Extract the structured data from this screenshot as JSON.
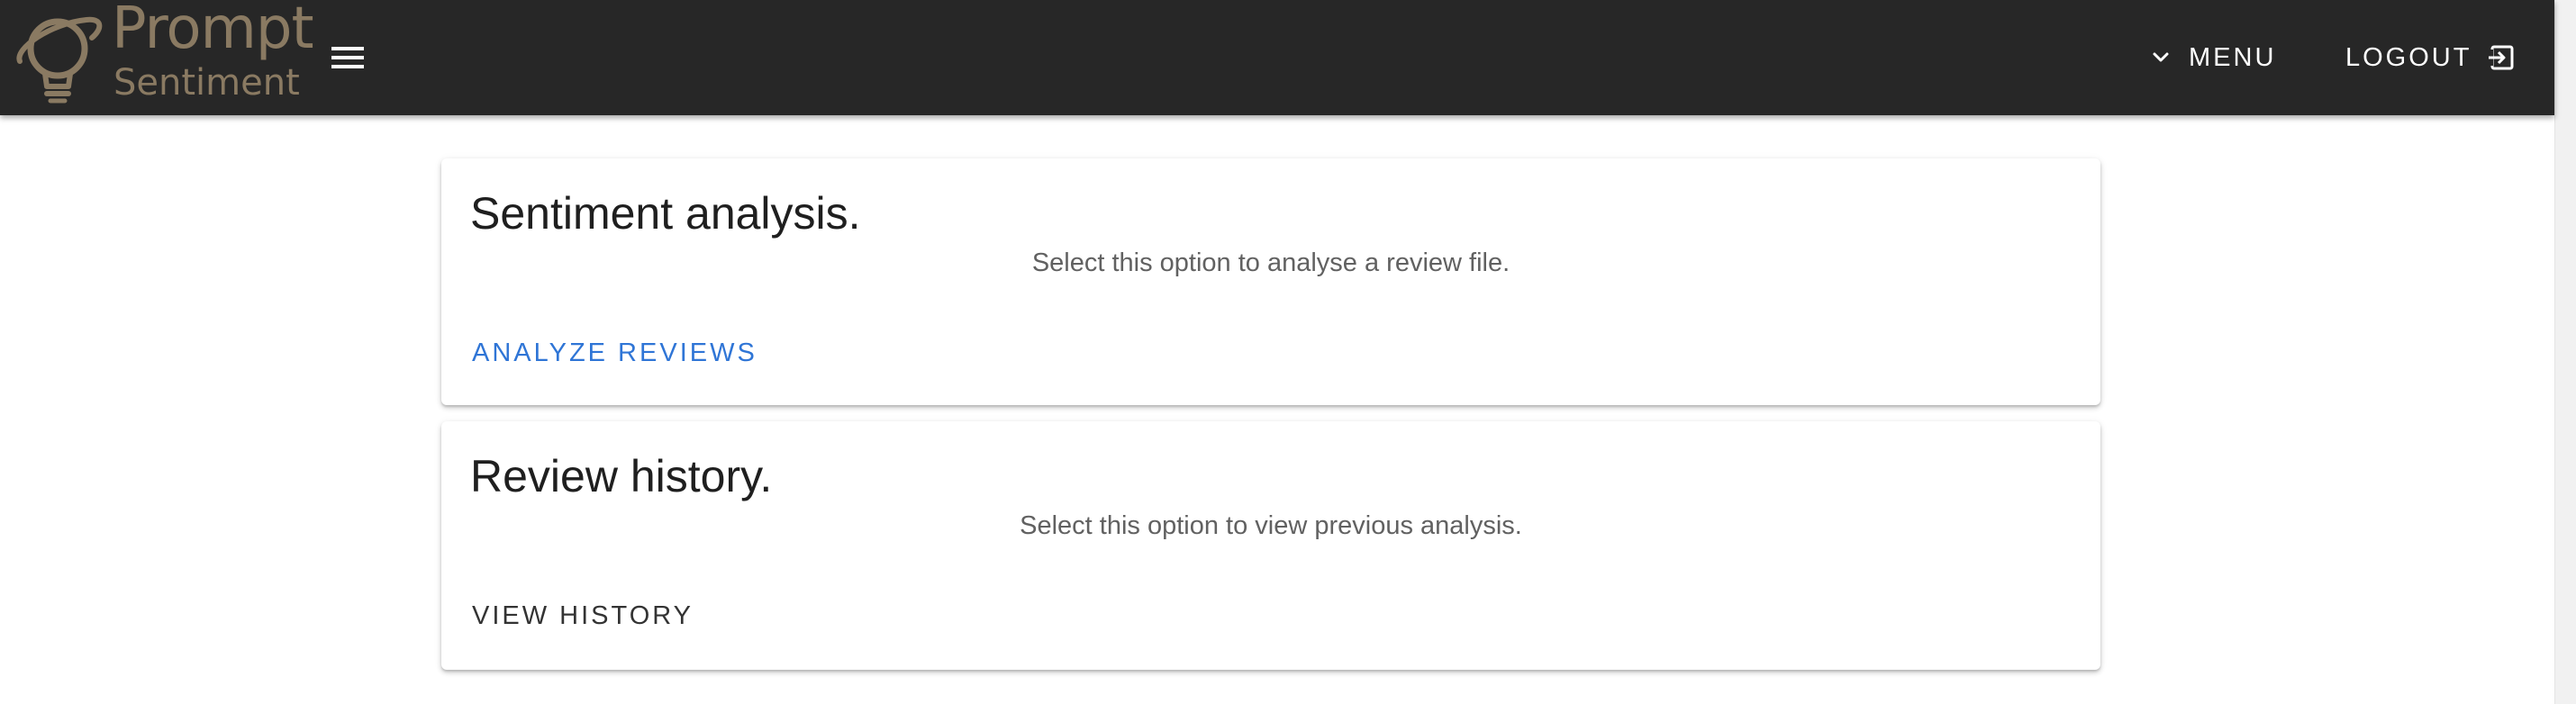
{
  "app": {
    "logo_line1": "Prompt",
    "logo_line2": "Sentiment",
    "brand_color": "#8a7a62",
    "bar_color": "#272727"
  },
  "header": {
    "menu_icon": "hamburger-icon",
    "menu_label": "MENU",
    "menu_chevron_icon": "chevron-down-icon",
    "logout_label": "LOGOUT",
    "logout_icon": "logout-icon"
  },
  "cards": [
    {
      "title": "Sentiment analysis.",
      "subtitle": "Select this option to analyse a review file.",
      "action_label": "ANALYZE REVIEWS",
      "action_color": "#2f75d6"
    },
    {
      "title": "Review history.",
      "subtitle": "Select this option to view previous analysis.",
      "action_label": "VIEW HISTORY",
      "action_color": "#333333"
    }
  ]
}
